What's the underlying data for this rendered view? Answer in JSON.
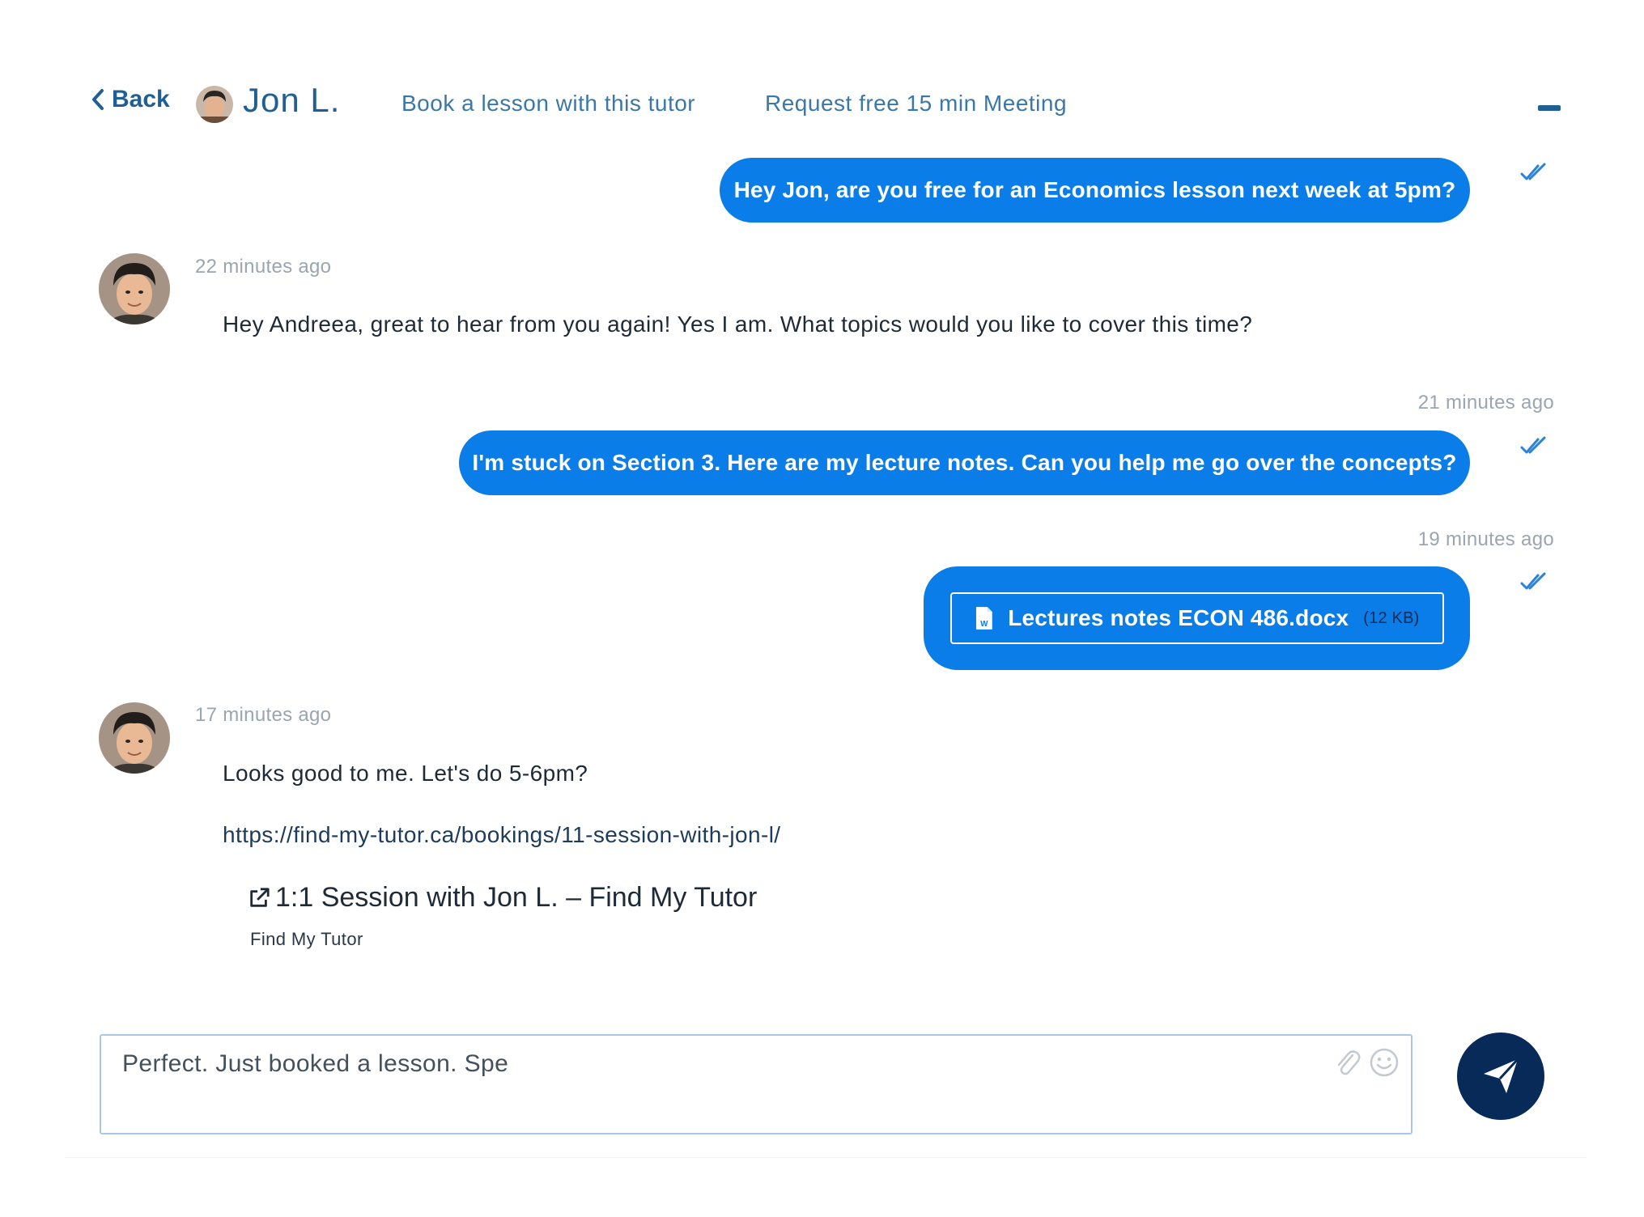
{
  "header": {
    "back_label": "Back",
    "tutor_name": "Jon L.",
    "book_link": "Book a lesson with this tutor",
    "meeting_link": "Request free 15 min Meeting"
  },
  "messages": [
    {
      "direction": "out",
      "text": "Hey Jon, are you free for an Economics lesson next week at 5pm?"
    },
    {
      "direction": "in",
      "timestamp": "22 minutes ago",
      "text": "Hey Andreea, great to hear from you again! Yes I am. What topics would you like to cover this time?"
    },
    {
      "direction": "out",
      "timestamp": "21 minutes ago",
      "text": "I'm stuck on Section 3. Here are my lecture notes. Can you help me go over the concepts?"
    },
    {
      "direction": "out",
      "timestamp": "19 minutes ago",
      "file_name": "Lectures notes ECON 486.docx",
      "file_size": "(12 KB)"
    },
    {
      "direction": "in",
      "timestamp": "17 minutes ago",
      "text": "Looks good to me. Let's do 5-6pm?",
      "url": "https://find-my-tutor.ca/bookings/11-session-with-jon-l/",
      "preview_title": "1:1 Session with Jon L. – Find My Tutor",
      "preview_site": "Find My Tutor"
    }
  ],
  "composer": {
    "value": "Perfect. Just booked a lesson. Spe"
  },
  "colors": {
    "bubble": "#0a7de8",
    "send_button": "#072a59",
    "header_blue": "#1f5f95"
  },
  "icons": {
    "back": "chevron-left-icon",
    "read": "double-check-icon",
    "file": "word-document-icon",
    "external": "external-link-icon",
    "attach": "paperclip-icon",
    "emoji": "smiley-icon",
    "send": "paper-plane-icon"
  }
}
